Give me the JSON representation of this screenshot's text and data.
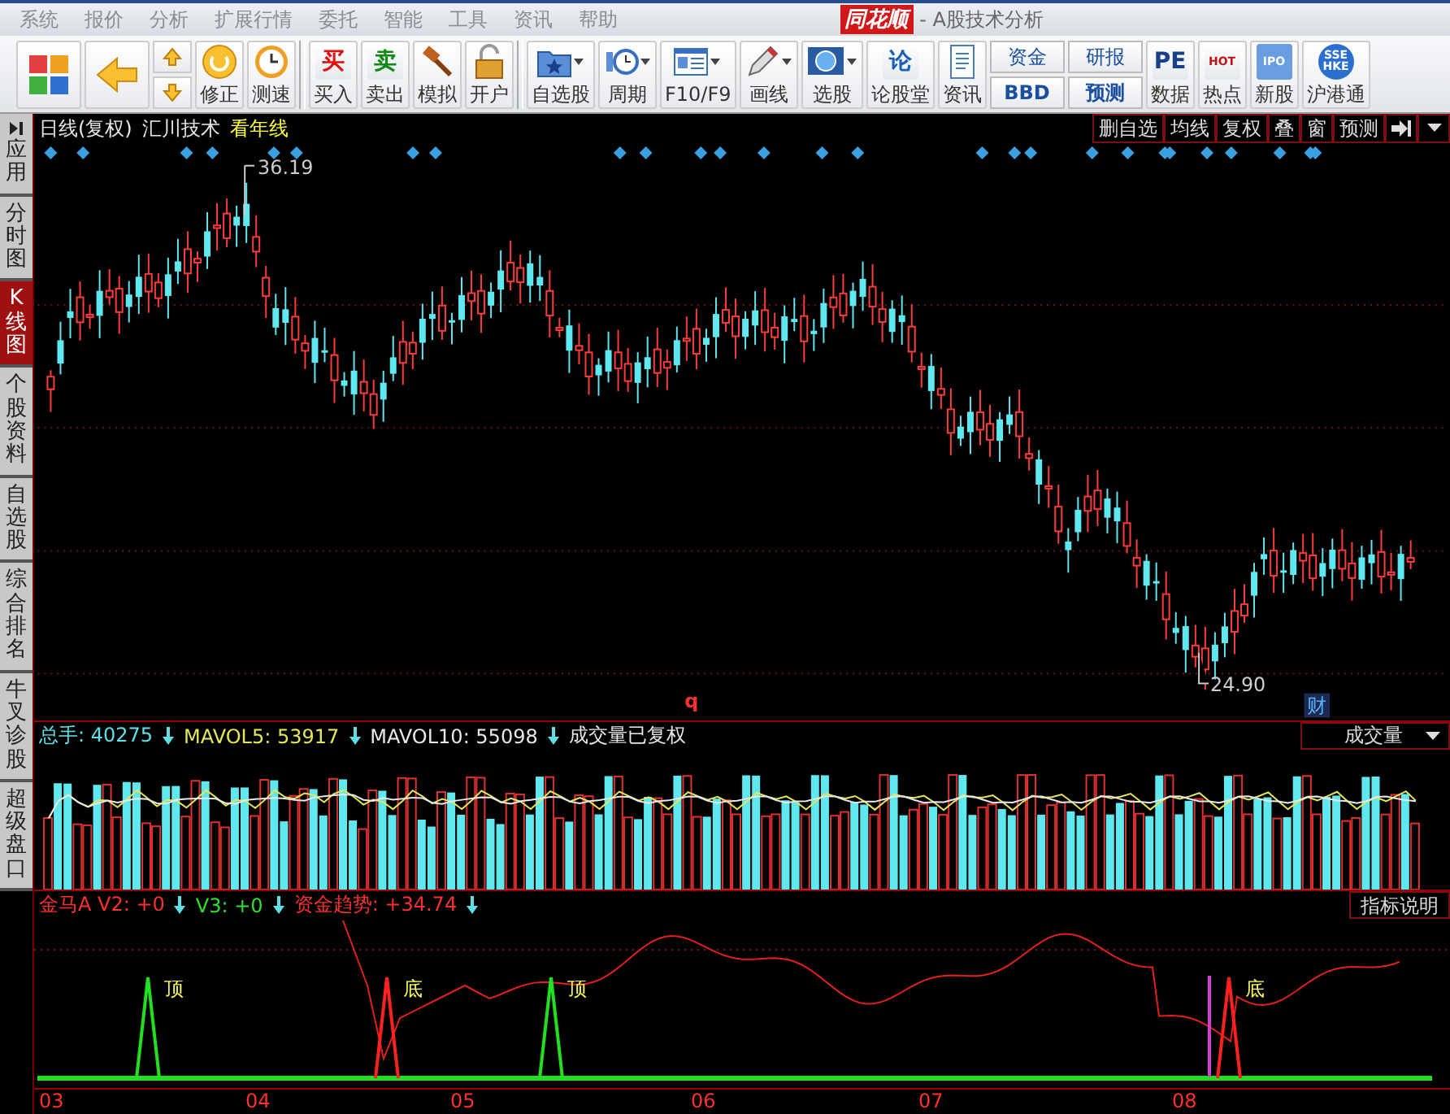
{
  "menu": [
    {
      "label": "系统"
    },
    {
      "label": "报价"
    },
    {
      "label": "分析"
    },
    {
      "label": "扩展行情"
    },
    {
      "label": "委托"
    },
    {
      "label": "智能"
    },
    {
      "label": "工具"
    },
    {
      "label": "资讯"
    },
    {
      "label": "帮助"
    }
  ],
  "title": {
    "logo": "同花顺",
    "text": "- A股技术分析"
  },
  "toolbar": [
    {
      "kind": "tile"
    },
    {
      "kind": "tile"
    },
    {
      "kind": "updown"
    },
    {
      "kind": "tool",
      "label": "修正"
    },
    {
      "kind": "tool",
      "label": "测速"
    },
    {
      "kind": "sep"
    },
    {
      "kind": "tool",
      "label": "买入",
      "glyph": "买",
      "color": "#e01010"
    },
    {
      "kind": "tool",
      "label": "卖出",
      "glyph": "卖",
      "color": "#108a10"
    },
    {
      "kind": "tool",
      "label": "模拟"
    },
    {
      "kind": "tool",
      "label": "开户"
    },
    {
      "kind": "sep"
    },
    {
      "kind": "split",
      "label": "自选股"
    },
    {
      "kind": "split",
      "label": "周期"
    },
    {
      "kind": "split",
      "label": "F10/F9"
    },
    {
      "kind": "split",
      "label": "画线"
    },
    {
      "kind": "split",
      "label": "选股"
    },
    {
      "kind": "tool",
      "label": "论股堂",
      "glyph": "论",
      "color": "#1a5fb4"
    },
    {
      "kind": "tool",
      "label": "资讯"
    },
    {
      "kind": "stack",
      "labels": [
        "资金",
        "BBD"
      ]
    },
    {
      "kind": "stack",
      "labels": [
        "研报",
        "预测"
      ]
    },
    {
      "kind": "tool",
      "label": "数据",
      "glyph": "PE",
      "color": "#1a3f8a"
    },
    {
      "kind": "tool",
      "label": "热点",
      "glyph": "HOT",
      "color": "#c01010"
    },
    {
      "kind": "badge",
      "label": "新股",
      "glyph": "IPO",
      "color": "#6a9ee0"
    },
    {
      "kind": "badge",
      "label": "沪港通",
      "glyph": "SSE HKE",
      "color": "#2a6fd0"
    }
  ],
  "sidebar": [
    {
      "label": "应用",
      "selected": false
    },
    {
      "label": "分时图",
      "selected": false
    },
    {
      "label": "K线图",
      "selected": true
    },
    {
      "label": "个股资料",
      "selected": false
    },
    {
      "label": "自选股",
      "selected": false
    },
    {
      "label": "综合排名",
      "selected": false
    },
    {
      "label": "牛叉诊股",
      "selected": false
    },
    {
      "label": "超级盘口",
      "selected": false
    }
  ],
  "chart_header": {
    "period": "日线(复权)",
    "stock": "汇川技术",
    "link": "看年线",
    "buttons": [
      "删自选",
      "均线",
      "复权",
      "叠",
      "窗",
      "预测"
    ]
  },
  "price_chart": {
    "high_label": "36.19",
    "low_label": "24.90",
    "marker_q": "q",
    "marker_cai": "财"
  },
  "volume_header": {
    "items": [
      {
        "label": "总手: 40275",
        "color": "#5fe0e6"
      },
      {
        "label": "MAVOL5: 53917",
        "color": "#e6e65a"
      },
      {
        "label": "MAVOL10: 55098",
        "color": "#e8e8e8"
      }
    ],
    "note": "成交量已复权",
    "dropdown": "成交量"
  },
  "indicator_header": {
    "items": [
      {
        "label": "金马A V2: +0",
        "color": "#ff3030"
      },
      {
        "label": "V3: +0",
        "color": "#30e030"
      },
      {
        "label": "资金趋势: +34.74",
        "color": "#ff3030"
      }
    ],
    "button": "指标说明"
  },
  "signals": [
    {
      "label": "顶",
      "kind": "top"
    },
    {
      "label": "底",
      "kind": "bottom"
    },
    {
      "label": "顶",
      "kind": "top"
    },
    {
      "label": "底",
      "kind": "bottom"
    }
  ],
  "x_axis": [
    "03",
    "04",
    "05",
    "06",
    "07",
    "08"
  ]
}
